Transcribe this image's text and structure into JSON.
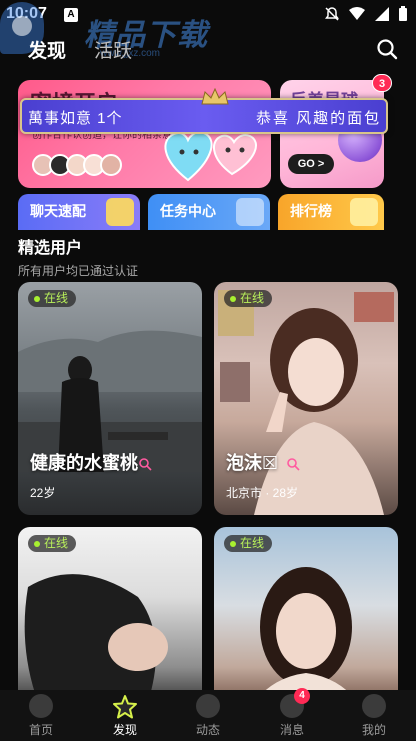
{
  "status_bar": {
    "time": "10:07",
    "app_badge": "A"
  },
  "watermark": {
    "text": "精品下载",
    "url": "www.jjxz.com"
  },
  "header": {
    "tabs": [
      {
        "label": "发现"
      },
      {
        "label": "活跃"
      }
    ]
  },
  "banners": {
    "main": {
      "title": "密境开启",
      "subtitle": "创作合作认创造，让你的相亲意",
      "avatars": [
        "#e7c2b6",
        "#2b2b2b",
        "#f3d7c9",
        "#f8e0d6",
        "#e2b3a5"
      ]
    },
    "right": {
      "title": "反差星球",
      "button": "GO >",
      "badge": "3"
    }
  },
  "notice": {
    "left_text": "萬事如意  1个",
    "right_text": "恭喜 风趣的面包"
  },
  "features": [
    {
      "label": "聊天速配",
      "sub": ""
    },
    {
      "label": "任务中心",
      "sub": ""
    },
    {
      "label": "排行榜",
      "sub": ""
    }
  ],
  "section": {
    "title": "精选用户",
    "subtitle": "所有用户均已通过认证"
  },
  "users": [
    {
      "status": "在线",
      "name": "健康的水蜜桃",
      "meta": "22岁"
    },
    {
      "status": "在线",
      "name": "泡沫☒",
      "meta": "北京市 · 28岁"
    },
    {
      "status": "在线",
      "name": "",
      "meta": ""
    },
    {
      "status": "在线",
      "name": "",
      "meta": ""
    }
  ],
  "bottom_nav": {
    "items": [
      {
        "label": "首页",
        "icon": "home-icon"
      },
      {
        "label": "发现",
        "icon": "star-icon"
      },
      {
        "label": "动态",
        "icon": "feed-icon"
      },
      {
        "label": "消息",
        "icon": "message-icon",
        "badge": "4"
      },
      {
        "label": "我的",
        "icon": "profile-icon"
      }
    ]
  },
  "colors": {
    "online": "#a8f030",
    "badge": "#ff2a55",
    "accent": "#d6f04a"
  }
}
